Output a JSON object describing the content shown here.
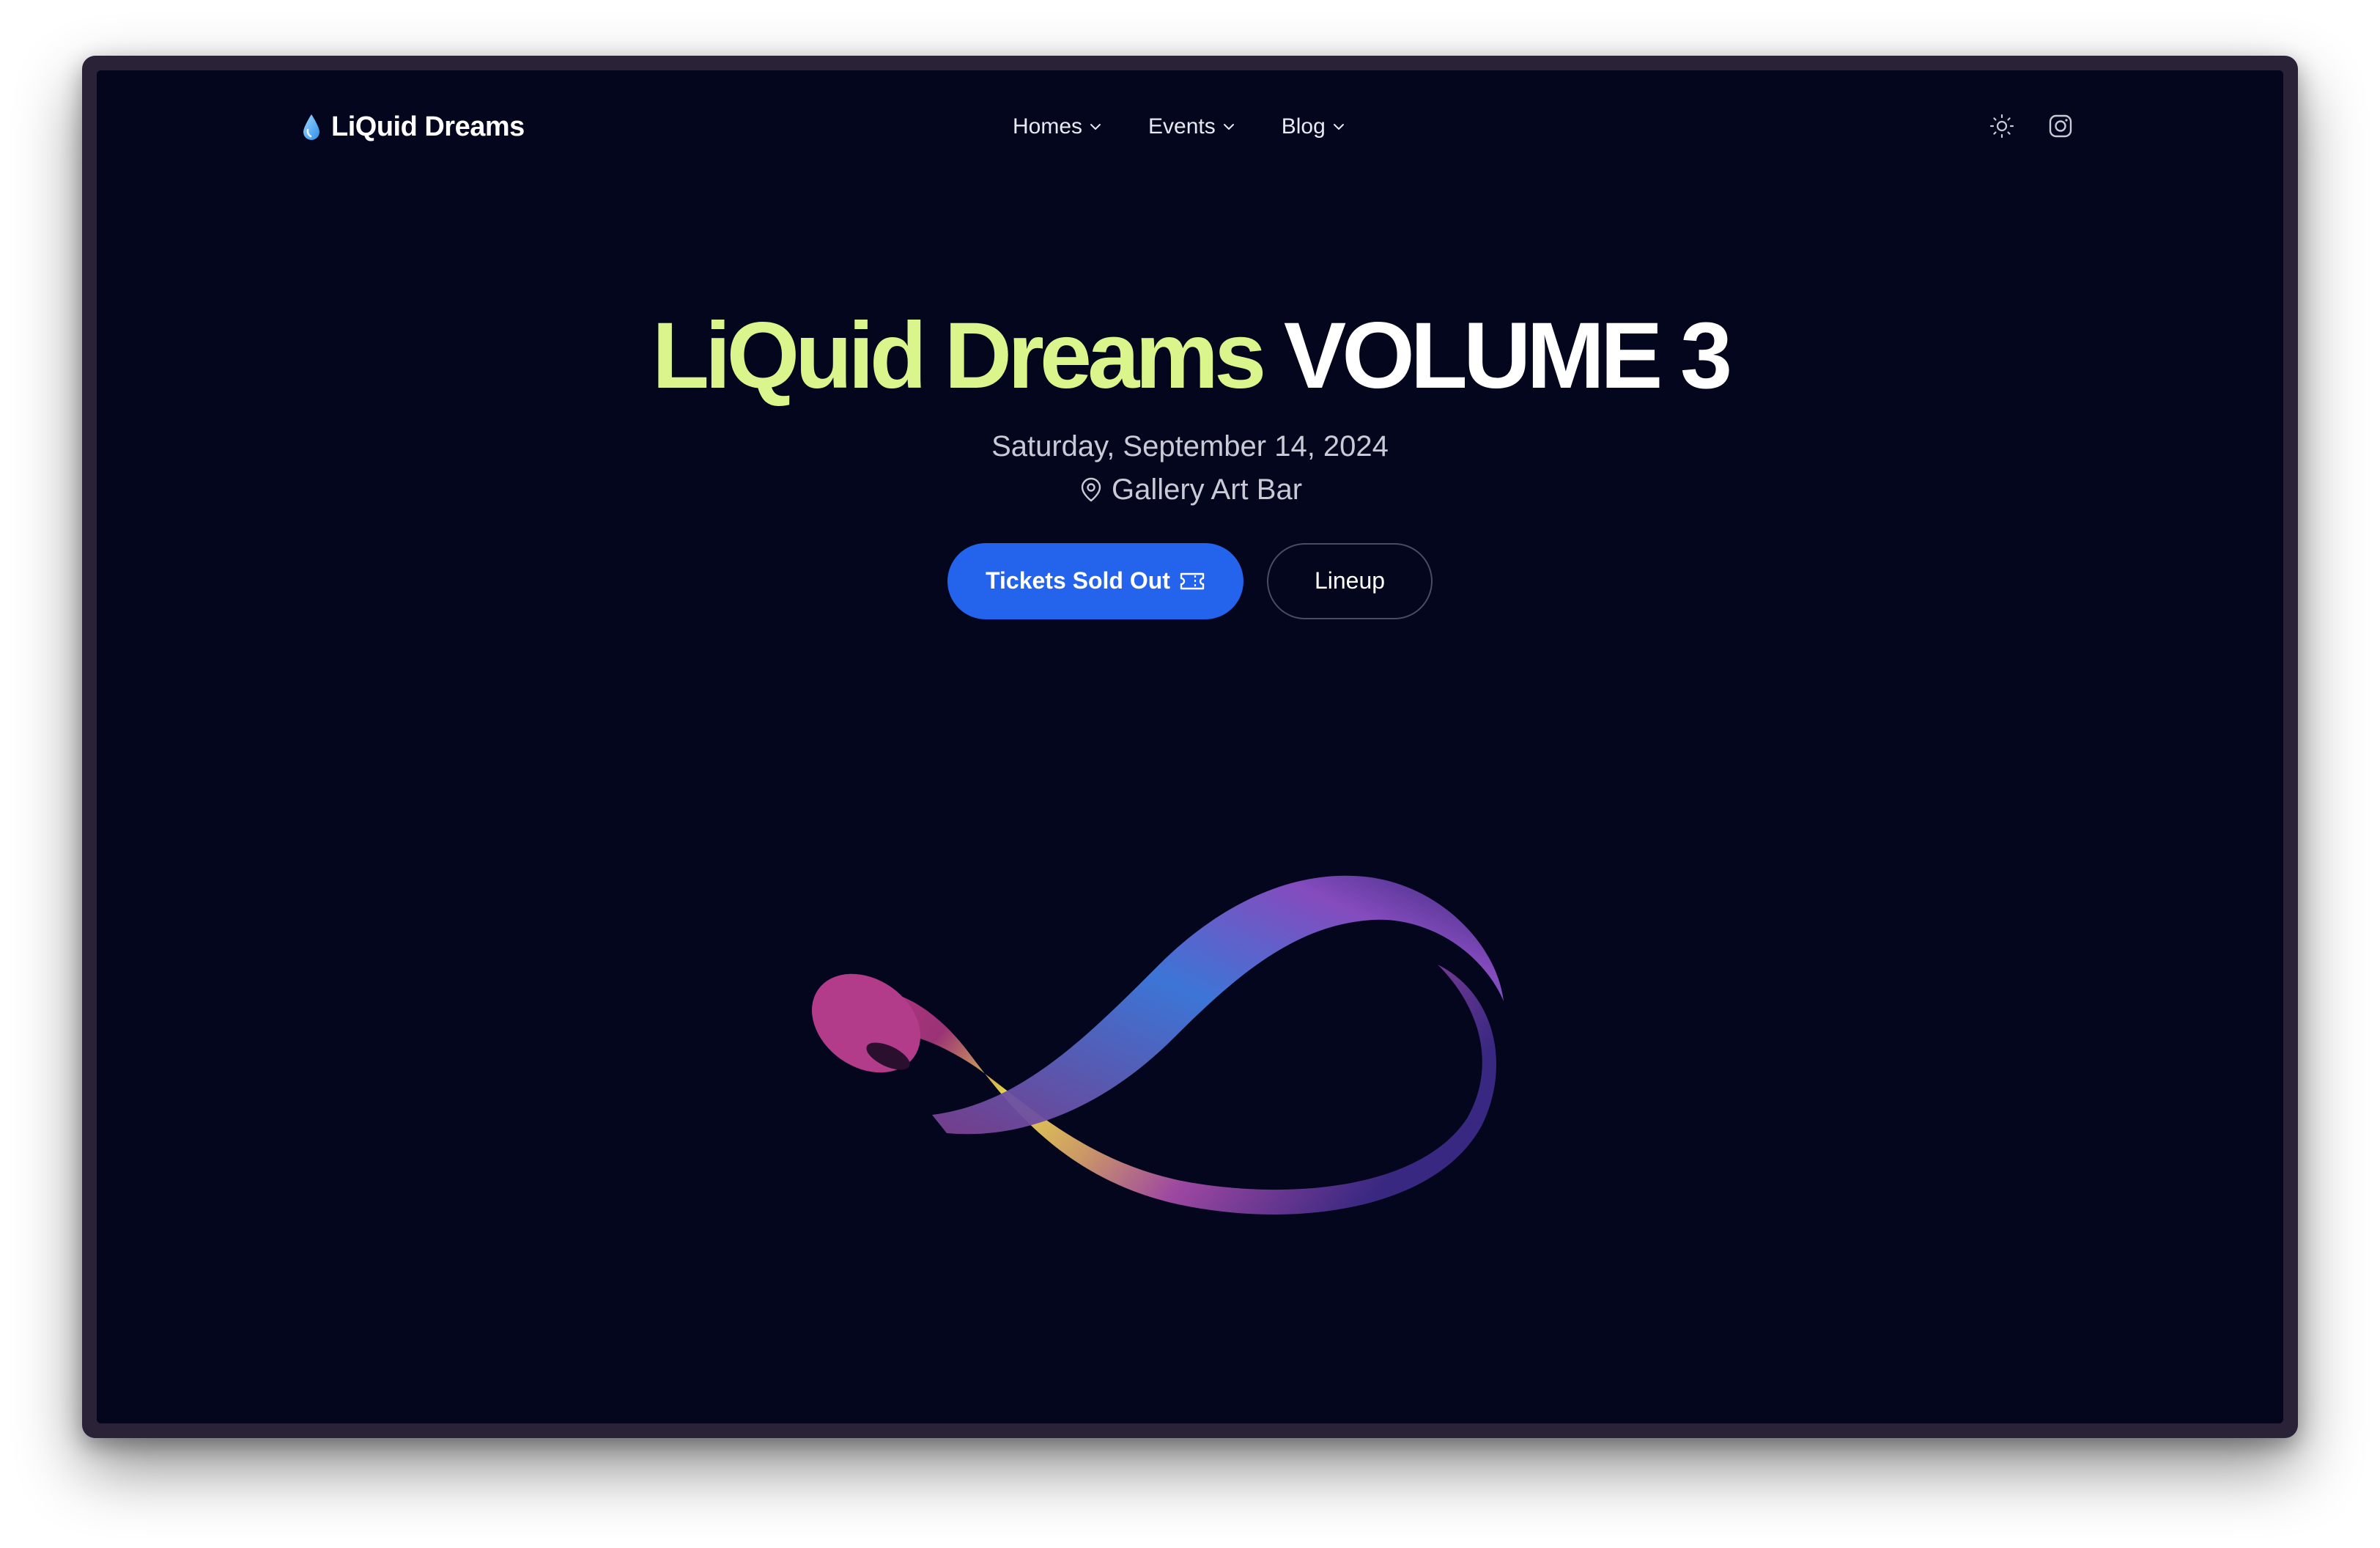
{
  "nav": {
    "logo_text": "LiQuid Dreams",
    "menu": [
      {
        "label": "Homes"
      },
      {
        "label": "Events"
      },
      {
        "label": "Blog"
      }
    ],
    "icons": [
      "sun-icon",
      "instagram-icon"
    ]
  },
  "hero": {
    "title_accent": "LiQuid Dreams",
    "title_rest": "VOLUME 3",
    "date": "Saturday, September 14, 2024",
    "venue": "Gallery Art Bar",
    "primary_button": "Tickets Sold Out",
    "secondary_button": "Lineup"
  },
  "colors": {
    "background": "#03061c",
    "accent": "#d9f58c",
    "primary": "#2463eb",
    "text": "#ffffff"
  }
}
